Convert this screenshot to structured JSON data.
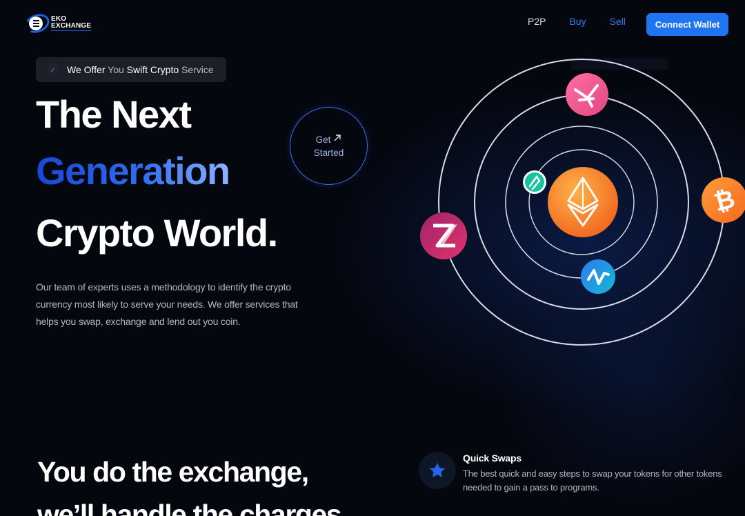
{
  "header": {
    "logo_line1": "EKO",
    "logo_line2": "EXCHANGE",
    "nav": {
      "p2p": "P2P",
      "buy": "Buy",
      "sell": "Sell"
    },
    "connect_wallet": "Connect Wallet"
  },
  "hero": {
    "badge_parts": [
      "We Offer ",
      "You ",
      "Swift ",
      "Crypto ",
      "Service"
    ],
    "title_line1": "The Next",
    "title_line2": "Generation",
    "title_line3": "Crypto World.",
    "description": "Our team of experts uses a methodology to identify the crypto currency most likely to serve your needs. We offer services that helps you swap, exchange and lend out you coin.",
    "get_started_line1": "Get",
    "get_started_line2": "Started"
  },
  "orbit": {
    "center_coin": "ethereum-icon",
    "coins": [
      "swap-coin-icon",
      "bitcoin-icon",
      "z-coin-icon",
      "n-coin-icon",
      "leaf-coin-icon"
    ]
  },
  "section2": {
    "heading_line1": "You do the exchange,",
    "heading_line2": "we’ll handle the charges"
  },
  "feature": {
    "title": "Quick Swaps",
    "description": "The best quick and easy steps to swap your tokens for other tokens needed to gain a pass to programs.",
    "icon": "star-icon"
  },
  "colors": {
    "accent": "#1f74f2",
    "background": "#05070f",
    "generation_gradient_start": "#1747d6",
    "generation_gradient_end": "#8fb2ff"
  }
}
